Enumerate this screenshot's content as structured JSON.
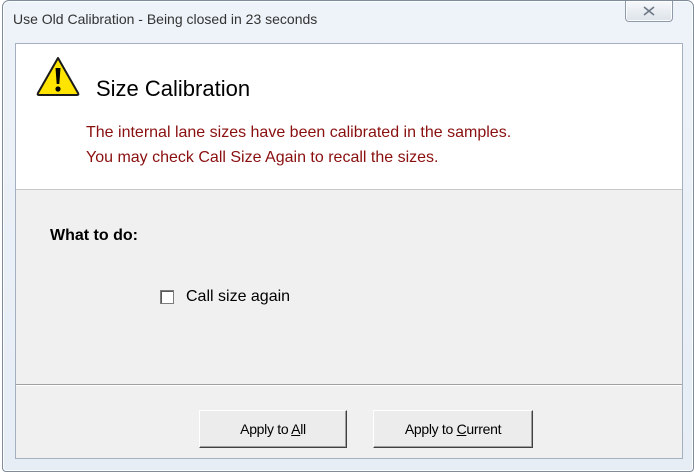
{
  "window": {
    "title": "Use Old Calibration - Being closed in 23 seconds"
  },
  "header": {
    "icon": "warning-icon",
    "title": "Size Calibration",
    "message_line1": "The internal lane sizes have been calibrated in the samples.",
    "message_line2": "You may check Call Size Again to recall the sizes."
  },
  "body": {
    "section_label": "What to do:",
    "checkbox": {
      "label": "Call size again",
      "checked": false
    }
  },
  "buttons": {
    "apply_all": {
      "prefix": "Apply to ",
      "mnemonic": "A",
      "suffix": "ll"
    },
    "apply_current": {
      "prefix": "Apply to ",
      "mnemonic": "C",
      "suffix": "urrent"
    }
  },
  "colors": {
    "message": "#8a0f0f",
    "warning_fill": "#ffe400"
  }
}
